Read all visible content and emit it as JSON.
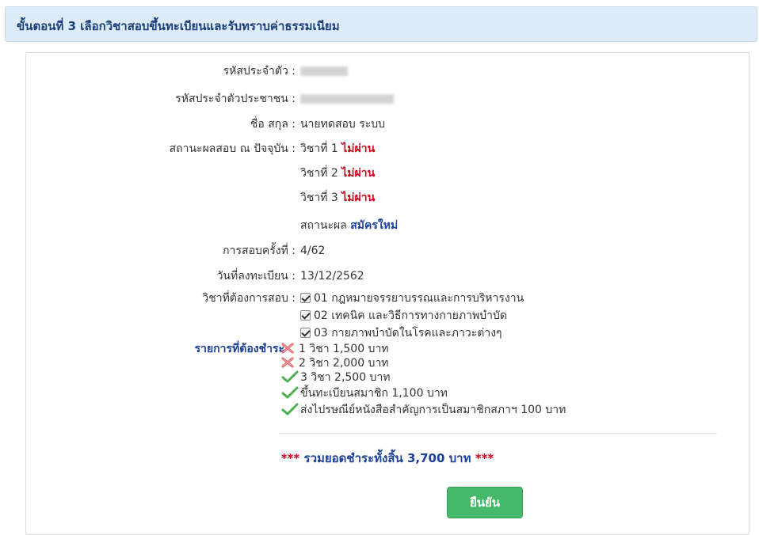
{
  "header": {
    "title": "ขั้นตอนที่ 3 เลือกวิชาสอบขึ้นทะเบียนและรับทราบค่าธรรมเนียม"
  },
  "fields": {
    "student_id_label": "รหัสประจำตัว :",
    "national_id_label": "รหัสประจำตัวประชาชน :",
    "name_label": "ชื่อ สกุล :",
    "name_value": "นายทดสอบ ระบบ",
    "status_label": "สถานะผลสอบ ณ ปัจจุบัน :",
    "subjects_status": [
      {
        "text": "วิชาที่ 1",
        "result": "ไม่ผ่าน"
      },
      {
        "text": "วิชาที่ 2",
        "result": "ไม่ผ่าน"
      },
      {
        "text": "วิชาที่ 3",
        "result": "ไม่ผ่าน"
      }
    ],
    "overall_status_text": "สถานะผล",
    "overall_status_value": "สมัครใหม่",
    "exam_round_label": "การสอบครั้งที่ :",
    "exam_round_value": "4/62",
    "register_date_label": "วันที่ลงทะเบียน :",
    "register_date_value": "13/12/2562",
    "subjects_label": "วิชาที่ต้องการสอบ :",
    "subjects": [
      "01 กฎหมายจรรยาบรรณและการบริหารงาน",
      "02 เทคนิค และวิธีการทางกายภาพบำบัด",
      "03 กายภาพบำบัดในโรคและภาวะต่างๆ"
    ],
    "payment_label": "รายการที่ต้องชำระ",
    "payment_items": [
      {
        "text": "1 วิชา 1,500 บาท",
        "selected": false
      },
      {
        "text": "2 วิชา 2,000 บาท",
        "selected": false
      },
      {
        "text": "3 วิชา 2,500 บาท",
        "selected": true
      },
      {
        "text": "ขึ้นทะเบียนสมาชิก 1,100 บาท",
        "selected": true
      },
      {
        "text": "ส่งไปรษณีย์หนังสือสำคัญการเป็นสมาชิกสภาฯ 100 บาท",
        "selected": true
      }
    ]
  },
  "total": {
    "stars": "***",
    "text": "รวมยอดชำระทั้งสิ้น 3,700 บาท"
  },
  "confirm_label": "ยืนยัน",
  "colors": {
    "fail": "#d0021b",
    "accent": "#1c3f9a",
    "button": "#46b86a",
    "header_bg": "#dcebf6"
  },
  "icons": {
    "unselected": "red-x-icon",
    "selected": "green-check-icon",
    "checkbox": "checked-checkbox-icon"
  }
}
